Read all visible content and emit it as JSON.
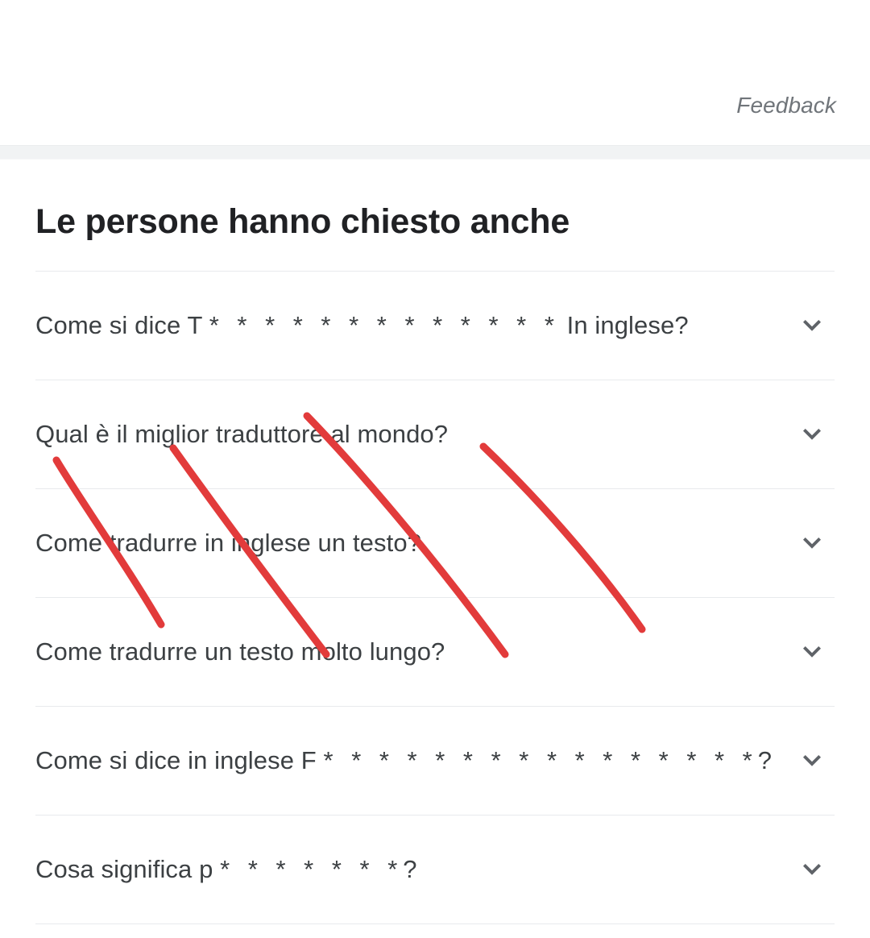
{
  "header": {
    "feedback_label": "Feedback"
  },
  "paa": {
    "heading": "Le persone hanno chiesto anche",
    "items": [
      {
        "prefix": "Come si dice T ",
        "stars": "* * * * * * * * * * * * *",
        "suffix": " In inglese?",
        "full_text": "Come si dice T * * * * * * * * * * * * * In inglese?",
        "expand_icon": "chevron-down-icon"
      },
      {
        "prefix": "Qual è il miglior traduttore al mondo?",
        "stars": "",
        "suffix": "",
        "full_text": "Qual è il miglior traduttore al mondo?",
        "expand_icon": "chevron-down-icon"
      },
      {
        "prefix": "Come tradurre in inglese un testo?",
        "stars": "",
        "suffix": "",
        "full_text": "Come tradurre in inglese un testo?",
        "expand_icon": "chevron-down-icon"
      },
      {
        "prefix": "Come tradurre un testo molto lungo?",
        "stars": "",
        "suffix": "",
        "full_text": "Come tradurre un testo molto lungo?",
        "expand_icon": "chevron-down-icon"
      },
      {
        "prefix": "Come si dice in inglese F ",
        "stars": "* * * * * * * * * * * * * * * *",
        "suffix": "?",
        "full_text": "Come si dice in inglese F * * * * * * * * * * * * * * * *?",
        "expand_icon": "chevron-down-icon"
      },
      {
        "prefix": "Cosa significa p ",
        "stars": "* * * * * * *",
        "suffix": "?",
        "full_text": "Cosa significa p * * * * * * *?",
        "expand_icon": "chevron-down-icon"
      }
    ]
  },
  "annotation": {
    "name": "red-pen-strokes",
    "color": "#e23b3b",
    "stroke_count": 4,
    "stroke_width": 9
  },
  "colors": {
    "page_background": "#ffffff",
    "band_background": "#f1f3f4",
    "divider": "#e8eaed",
    "heading_text": "#202124",
    "question_text": "#3c4043",
    "muted_text": "#70757a",
    "annotation_red": "#e23b3b"
  }
}
